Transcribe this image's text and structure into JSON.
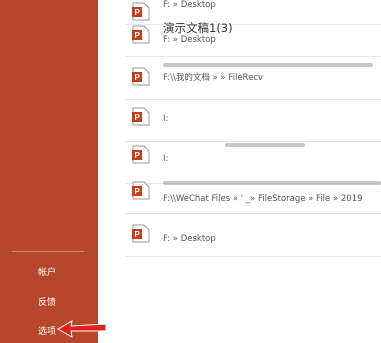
{
  "sidebar": {
    "items": [
      {
        "label": "帐户"
      },
      {
        "label": "反馈"
      },
      {
        "label": "选项"
      }
    ]
  },
  "files": [
    {
      "name": "",
      "path": "F: » Desktop"
    },
    {
      "name": "演示文稿1(3)",
      "path": "F: » Desktop"
    },
    {
      "name": "",
      "path": "F:\\\\我的文档 »                     » FileRecv"
    },
    {
      "name": "",
      "path": "I:"
    },
    {
      "name": "",
      "path": "I:"
    },
    {
      "name": "",
      "path": "F:\\\\WeChat Files » '           _» FileStorage » File » 2019"
    },
    {
      "name": "",
      "path": "F: » Desktop"
    }
  ],
  "colors": {
    "sidebar_bg": "#b7472a",
    "ppt_icon": "#c43e1c",
    "arrow": "#e02020"
  },
  "icons": {
    "file_icon": "powerpoint-file-icon",
    "pointer": "red-arrow-icon"
  }
}
